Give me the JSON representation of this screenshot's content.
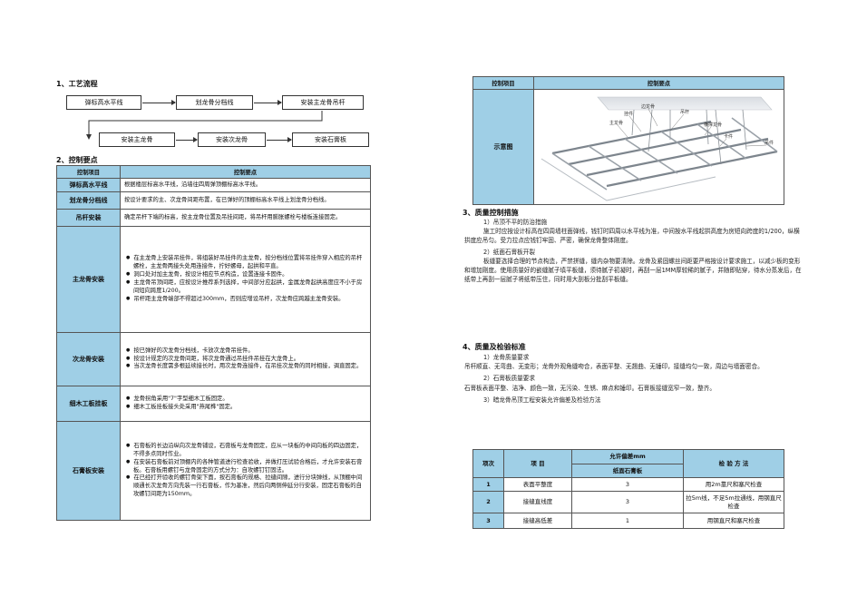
{
  "left": {
    "s1_title": "1、工艺流程",
    "flow_row1": [
      "弹标高水平线",
      "划龙骨分档线",
      "安装主龙骨吊杆"
    ],
    "flow_row2": [
      "安装主龙骨",
      "安装次龙骨",
      "安装石膏板"
    ],
    "s2_title": "2、控制要点",
    "table_header": [
      "控制项目",
      "控制要点"
    ],
    "rows": [
      {
        "label": "弹标高水平线",
        "lines": [
          "根据楼层标高水平线，沿墙往四周弹顶棚标高水平线。"
        ]
      },
      {
        "label": "划龙骨分档线",
        "lines": [
          "按设计要求的主、次龙骨间距布置，在已弹好的顶棚标高水平线上划龙骨分档线。"
        ]
      },
      {
        "label": "吊杆安装",
        "lines": [
          "确定吊杆下端的标高，按主龙骨位置及吊挂间距，将吊杆用膨胀螺栓与楼板连接固定。"
        ]
      },
      {
        "label": "主龙骨安装",
        "bullets": [
          "在主龙骨上安装吊挂件，将组装好吊挂件的主龙骨，按分档线位置将吊挂件穿入相应的吊杆螺栓，主龙骨两接头处用连接件，拧好螺母，起拱和平直。",
          "洞口处对加主龙骨，按设计相应节点构造，设置连接卡固件。",
          "主龙骨吊顶间距，应按设计推荐系列选择，中间部分应起拱，金属龙骨起拱高度应不小于房间短向跨度1/200。",
          "吊杆距主龙骨端部不得超过300mm，否则应增设吊杆，次龙骨应跨越主龙骨安装。"
        ]
      },
      {
        "label": "次龙骨安装",
        "bullets": [
          "按已弹好的次龙骨分档线，卡放次龙骨吊挂件。",
          "按设计规定的次龙骨间距，将次龙骨通过吊挂件吊挂在大龙骨上。",
          "当次龙骨长度需多根延续接长时，用次龙骨连接件，在吊挂次龙骨的同时相接，调直固定。"
        ]
      },
      {
        "label": "细木工板挂板",
        "bullets": [
          "龙骨拐角采用\"7\"字型细木工板固定。",
          "细木工板挂板接头处采用\"燕尾榫\"固定。"
        ]
      },
      {
        "label": "石膏板安装",
        "bullets": [
          "石膏板的长边沿纵向次龙骨铺设，石膏板与龙骨固定，应从一块板的中间向板的四边固定，不得多点同时作业。",
          "在安装石膏板前对顶棚内的各种管道进行检查验收，并做打压试验合格后，才允许安装石膏板。石膏板用螺钉与龙骨固定的方式分为：自攻螺钉钉固法。",
          "在已经打开验收的螺钉骨架下面，按石膏板的规格、拉缝间隙，进行分块弹线，从顶棚中间顺通长次龙骨方向先装一行石膏板，作为基准，然后向两侧伸延分行安装，固定石膏板的自攻螺钉间距为150mm。"
        ]
      }
    ]
  },
  "right": {
    "top_header": [
      "控制项目",
      "控制要点"
    ],
    "diagram_label": "示意图",
    "diagram_tags": [
      "边龙骨",
      "挂件",
      "主龙骨",
      "吊杆",
      "横撑龙骨",
      "卡件",
      "吊件"
    ],
    "s3_title": "3、质量控制措施",
    "s3_items": [
      {
        "head": "1）吊顶不平的防治措施",
        "body": "施工时应按设计标高在四周墙柱面弹线，钱钉时四周以水平线为准，中间按水平线起拱高度为房短向跨度的1/200，纵横拱度应吊匀。受力拉点应钱钉牢固、严密，确保龙骨整体刚度。"
      },
      {
        "head": "2）纸面石膏板开裂",
        "body": "板缝要选择合理的节点构造，严禁拼缝，缝内杂物要清除。龙骨及紧固螺丝间距要严格按设计要求施工，以减少板的变形和增加刚度。使用质量好的嵌缝腻子填平板缝，须待腻子初凝时，再刮一层1MM厚较稀的腻子，并随即贴穿，待水分蒸发后，在纸带上再刮一层腻子将纸带压住，同时用大刮板分批刮平板缝。"
      }
    ],
    "s4_title": "4、质量及检验标准",
    "s4_items": [
      {
        "head": "1）龙骨质量要求",
        "body": "吊杆顺直、无弯曲、无变形；龙骨外观角缝吻合，表面平整、无翘曲、无锤印，接缝均匀一致，周边与墙面密合。"
      },
      {
        "head": "2）石膏板质量要求",
        "body": "石膏板表面平整、洁净、颜色一致，无污染、生锈、麻点和锤印。石膏板接缝宽窄一致，整齐。"
      },
      {
        "head": "3）暗龙骨吊顶工程安装允许偏差及检验方法",
        "body": ""
      }
    ],
    "qa_table": {
      "h_no": "项次",
      "h_item": "项  目",
      "h_dev": "允许偏差mm",
      "h_dev_sub": "纸面石膏板",
      "h_method": "检  验  方  法",
      "rows": [
        {
          "no": "1",
          "item": "表面平整度",
          "dev": "3",
          "method": "用2m靠尺和塞尺检查"
        },
        {
          "no": "2",
          "item": "接缝直线度",
          "dev": "3",
          "method": "拉5m线，不足5m拉通线，用钢直尺检查"
        },
        {
          "no": "3",
          "item": "接缝高低差",
          "dev": "1",
          "method": "用钢直尺和塞尺检查"
        }
      ]
    }
  }
}
